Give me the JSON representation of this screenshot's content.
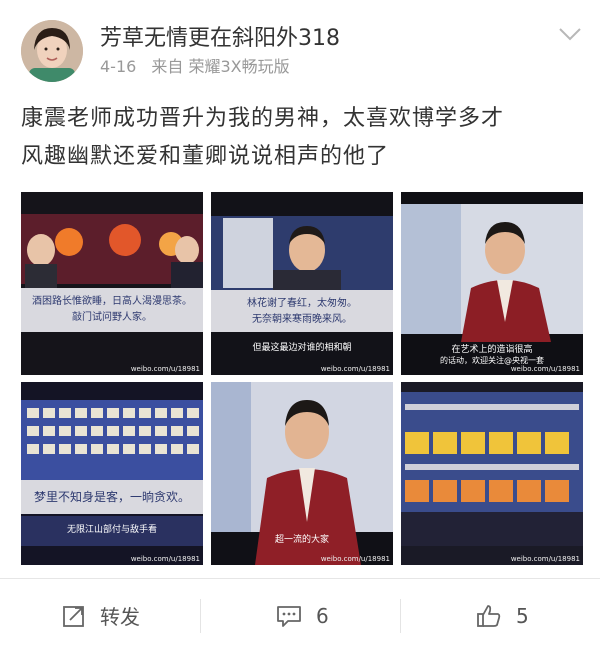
{
  "post": {
    "username": "芳草无情更在斜阳外318",
    "date": "4-16",
    "source": "来自 荣耀3X畅玩版",
    "text_line1": "康震老师成功晋升为我的男神，太喜欢博学多才",
    "text_line2": "风趣幽默还爱和董卿说说相声的他了"
  },
  "images": [
    {
      "caption": "酒困路长惟欲睡，日高人渴漫思茶。",
      "caption2": "敲门试问野人家。",
      "watermark": "weibo.com/u/18981"
    },
    {
      "caption": "林花谢了春红，太匆匆。",
      "caption2": "无奈朝来寒雨晚来风。",
      "subtitle": "但最这最边对谁的相和朝",
      "watermark": "weibo.com/u/18981"
    },
    {
      "subtitle": "在艺术上的造诣很高",
      "ticker": "的话动，欢迎关注@央视一套",
      "watermark": "weibo.com/u/18981"
    },
    {
      "caption": "梦里不知身是客，一晌贪欢。",
      "subtitle": "无限江山部付与敌手看",
      "watermark": "weibo.com/u/18981"
    },
    {
      "subtitle": "超一流的大家",
      "watermark": "weibo.com/u/18981"
    },
    {
      "watermark": "weibo.com/u/18981"
    }
  ],
  "actions": {
    "repost_label": "转发",
    "comment_count": "6",
    "like_count": "5"
  },
  "colors": {
    "accent": "#f4a100",
    "stage_blue": "#2d4f9e",
    "stage_red": "#b0232a"
  }
}
